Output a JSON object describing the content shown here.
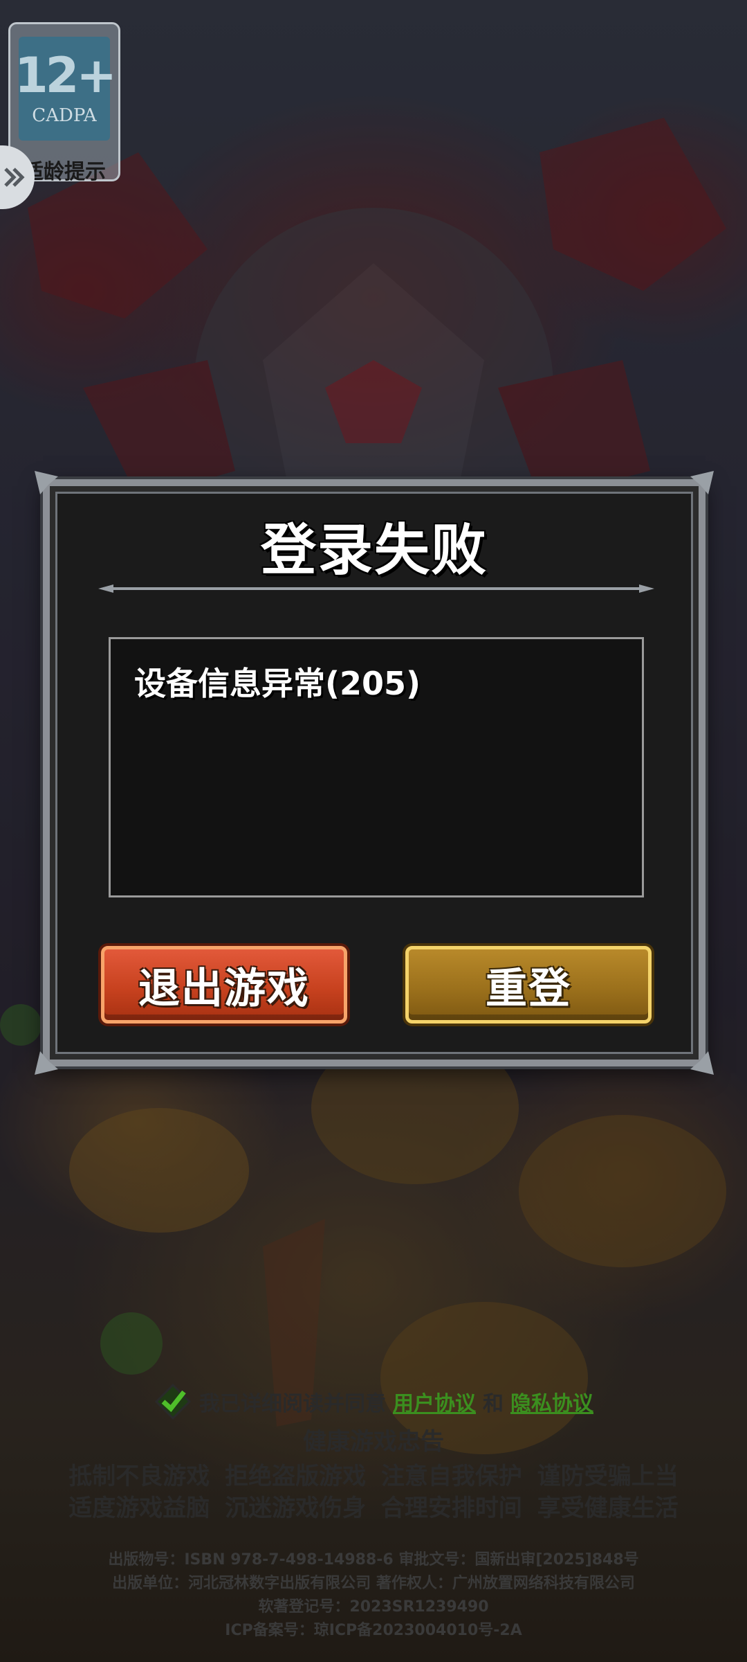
{
  "age_badge": {
    "rating": "12+",
    "org": "CADPA",
    "tip": "适龄提示"
  },
  "dialog": {
    "title": "登录失败",
    "message": "设备信息异常(205)",
    "exit_label": "退出游戏",
    "relogin_label": "重登"
  },
  "agreement": {
    "prefix": "我已详细阅读并同意",
    "user_agreement": "用户协议",
    "and": "和",
    "privacy_agreement": "隐私协议"
  },
  "health_notice": {
    "title": "健康游戏忠告",
    "line1": "抵制不良游戏  拒绝盗版游戏  注意自我保护  谨防受骗上当",
    "line2": "适度游戏益脑  沉迷游戏伤身  合理安排时间  享受健康生活"
  },
  "publication": {
    "line1": "出版物号：ISBN 978-7-498-14988-6 审批文号：国新出审[2025]848号",
    "line2": "出版单位：河北冠林数字出版有限公司 著作权人：广州放置网络科技有限公司",
    "line3": "软著登记号：2023SR1239490",
    "line4": "ICP备案号：琼ICP备2023004010号-2A"
  },
  "colors": {
    "exit_button": "#c8421f",
    "relogin_button": "#9c711c",
    "link_green": "#3b8f1f",
    "dialog_bg": "#1b1b1b"
  }
}
